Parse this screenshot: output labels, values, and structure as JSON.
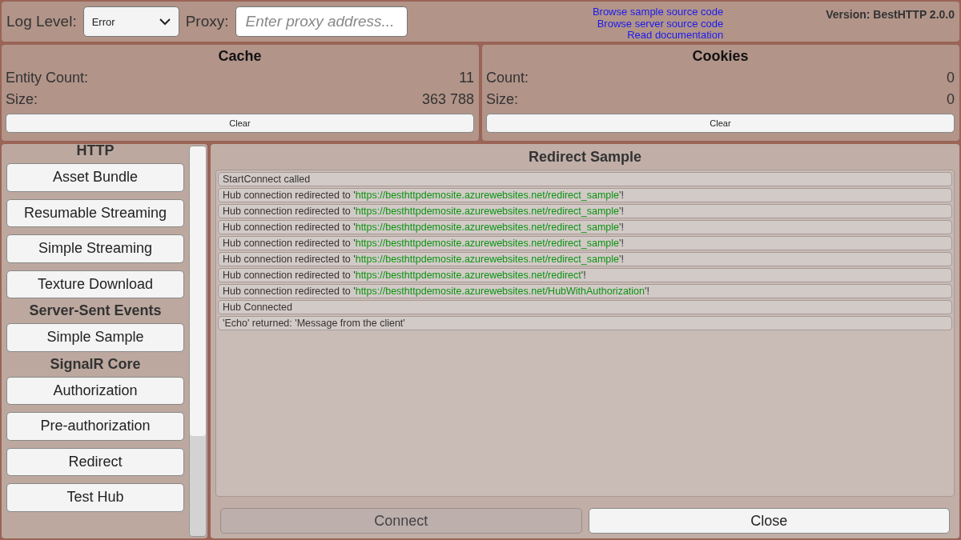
{
  "toolbar": {
    "log_level_label": "Log Level:",
    "log_level": "Error",
    "proxy_label": "Proxy:",
    "proxy_placeholder": "Enter proxy address...",
    "links": [
      "Browse sample source code",
      "Browse server source code",
      "Read documentation"
    ],
    "version": "Version: BestHTTP 2.0.0"
  },
  "cache": {
    "title": "Cache",
    "rows": [
      {
        "label": "Entity Count:",
        "value": "11"
      },
      {
        "label": "Size:",
        "value": "363 788"
      }
    ],
    "button": "Clear"
  },
  "cookies": {
    "title": "Cookies",
    "rows": [
      {
        "label": "Count:",
        "value": "0"
      },
      {
        "label": "Size:",
        "value": "0"
      }
    ],
    "button": "Clear"
  },
  "sidebar": {
    "sections": [
      {
        "title": "HTTP",
        "items": [
          "Asset Bundle",
          "Resumable Streaming",
          "Simple Streaming",
          "Texture Download"
        ]
      },
      {
        "title": "Server-Sent Events",
        "items": [
          "Simple Sample"
        ]
      },
      {
        "title": "SignalR Core",
        "items": [
          "Authorization",
          "Pre-authorization",
          "Redirect",
          "Test Hub"
        ]
      }
    ]
  },
  "sample": {
    "title": "Redirect Sample",
    "log": [
      {
        "parts": [
          {
            "text": "StartConnect called",
            "kind": "plain"
          }
        ]
      },
      {
        "parts": [
          {
            "text": "Hub connection redirected to '",
            "kind": "plain"
          },
          {
            "text": "https://besthttpdemosite.azurewebsites.net/redirect_sample",
            "kind": "url"
          },
          {
            "text": "'!",
            "kind": "plain"
          }
        ]
      },
      {
        "parts": [
          {
            "text": "Hub connection redirected to '",
            "kind": "plain"
          },
          {
            "text": "https://besthttpdemosite.azurewebsites.net/redirect_sample",
            "kind": "url"
          },
          {
            "text": "'!",
            "kind": "plain"
          }
        ]
      },
      {
        "parts": [
          {
            "text": "Hub connection redirected to '",
            "kind": "plain"
          },
          {
            "text": "https://besthttpdemosite.azurewebsites.net/redirect_sample",
            "kind": "url"
          },
          {
            "text": "'!",
            "kind": "plain"
          }
        ]
      },
      {
        "parts": [
          {
            "text": "Hub connection redirected to '",
            "kind": "plain"
          },
          {
            "text": "https://besthttpdemosite.azurewebsites.net/redirect_sample",
            "kind": "url"
          },
          {
            "text": "'!",
            "kind": "plain"
          }
        ]
      },
      {
        "parts": [
          {
            "text": "Hub connection redirected to '",
            "kind": "plain"
          },
          {
            "text": "https://besthttpdemosite.azurewebsites.net/redirect_sample",
            "kind": "url"
          },
          {
            "text": "'!",
            "kind": "plain"
          }
        ]
      },
      {
        "parts": [
          {
            "text": "Hub connection redirected to '",
            "kind": "plain"
          },
          {
            "text": "https://besthttpdemosite.azurewebsites.net/redirect",
            "kind": "url"
          },
          {
            "text": "'!",
            "kind": "plain"
          }
        ]
      },
      {
        "parts": [
          {
            "text": "Hub connection redirected to '",
            "kind": "plain"
          },
          {
            "text": "https://besthttpdemosite.azurewebsites.net/HubWithAuthorization",
            "kind": "url"
          },
          {
            "text": "'!",
            "kind": "plain"
          }
        ]
      },
      {
        "parts": [
          {
            "text": "Hub Connected",
            "kind": "plain"
          }
        ]
      },
      {
        "parts": [
          {
            "text": " 'Echo' returned: 'Message from the client'",
            "kind": "plain"
          }
        ]
      }
    ],
    "buttons": [
      {
        "label": "Connect",
        "disabled": true
      },
      {
        "label": "Close",
        "disabled": false
      }
    ]
  }
}
